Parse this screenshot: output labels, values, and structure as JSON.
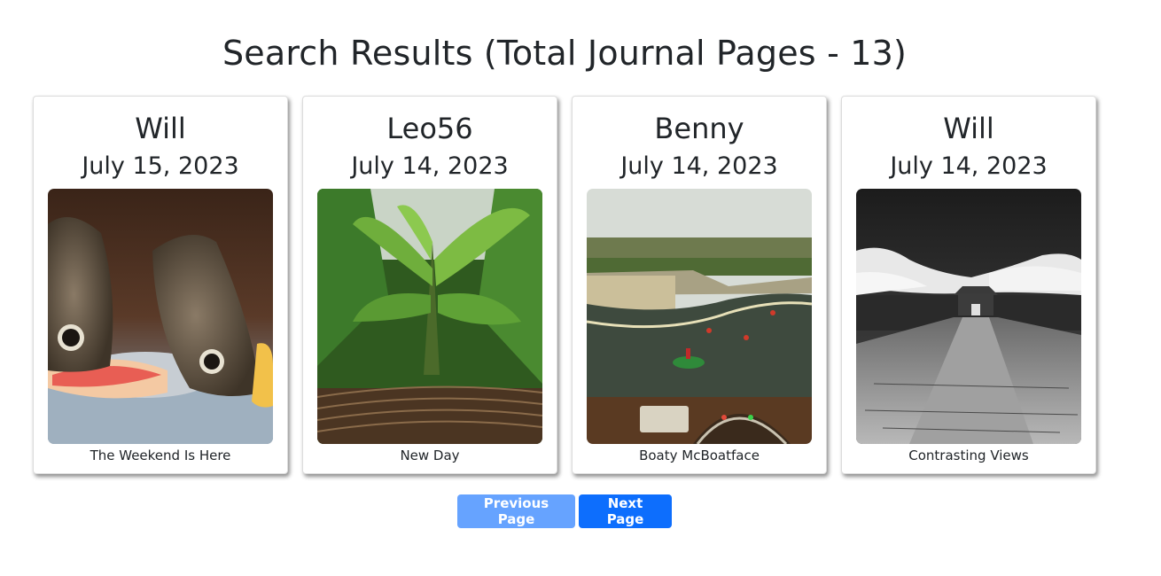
{
  "page": {
    "title": "Search Results (Total Journal Pages - 13)"
  },
  "cards": [
    {
      "author": "Will",
      "date": "July 15, 2023",
      "caption": "The Weekend Is Here",
      "image": "butterflies-on-grapefruit"
    },
    {
      "author": "Leo56",
      "date": "July 14, 2023",
      "caption": "New Day",
      "image": "banana-plant-jungle"
    },
    {
      "author": "Benny",
      "date": "July 14, 2023",
      "caption": "Boaty McBoatface",
      "image": "model-boat-pond"
    },
    {
      "author": "Will",
      "date": "July 14, 2023",
      "caption": "Contrasting Views",
      "image": "black-white-fort-path"
    }
  ],
  "pagination": {
    "previous_label": "Previous Page",
    "next_label": "Next Page"
  },
  "colors": {
    "previous_button": "#66a3ff",
    "next_button": "#0d6efd",
    "text": "#212529"
  }
}
